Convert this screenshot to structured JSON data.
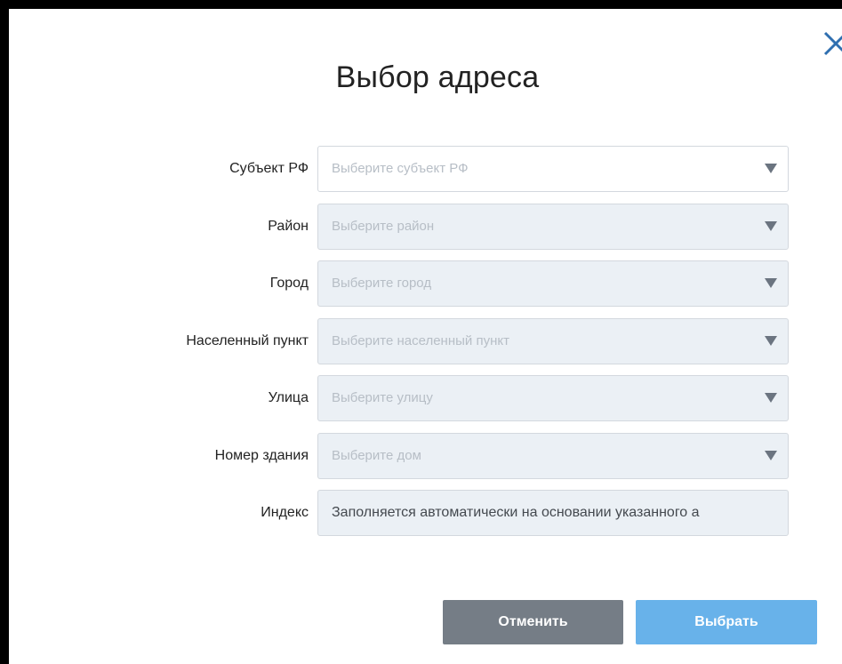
{
  "dialog": {
    "title": "Выбор адреса",
    "close_icon": "close-icon"
  },
  "fields": [
    {
      "label": "Субъект РФ",
      "placeholder": "Выберите субъект РФ",
      "enabled": true
    },
    {
      "label": "Район",
      "placeholder": "Выберите район",
      "enabled": false
    },
    {
      "label": "Город",
      "placeholder": "Выберите город",
      "enabled": false
    },
    {
      "label": "Населенный пункт",
      "placeholder": "Выберите населенный пункт",
      "enabled": false
    },
    {
      "label": "Улица",
      "placeholder": "Выберите улицу",
      "enabled": false
    },
    {
      "label": "Номер здания",
      "placeholder": "Выберите дом",
      "enabled": false
    }
  ],
  "index_field": {
    "label": "Индекс",
    "value": "Заполняется автоматически на основании указанного а"
  },
  "buttons": {
    "cancel": "Отменить",
    "select": "Выбрать"
  },
  "colors": {
    "cancel_bg": "#757d86",
    "select_bg": "#68b2ea",
    "disabled_field_bg": "#ebf0f5",
    "close_icon": "#2f6fb0"
  },
  "icons": {
    "dropdown": "chevron-down-icon"
  }
}
